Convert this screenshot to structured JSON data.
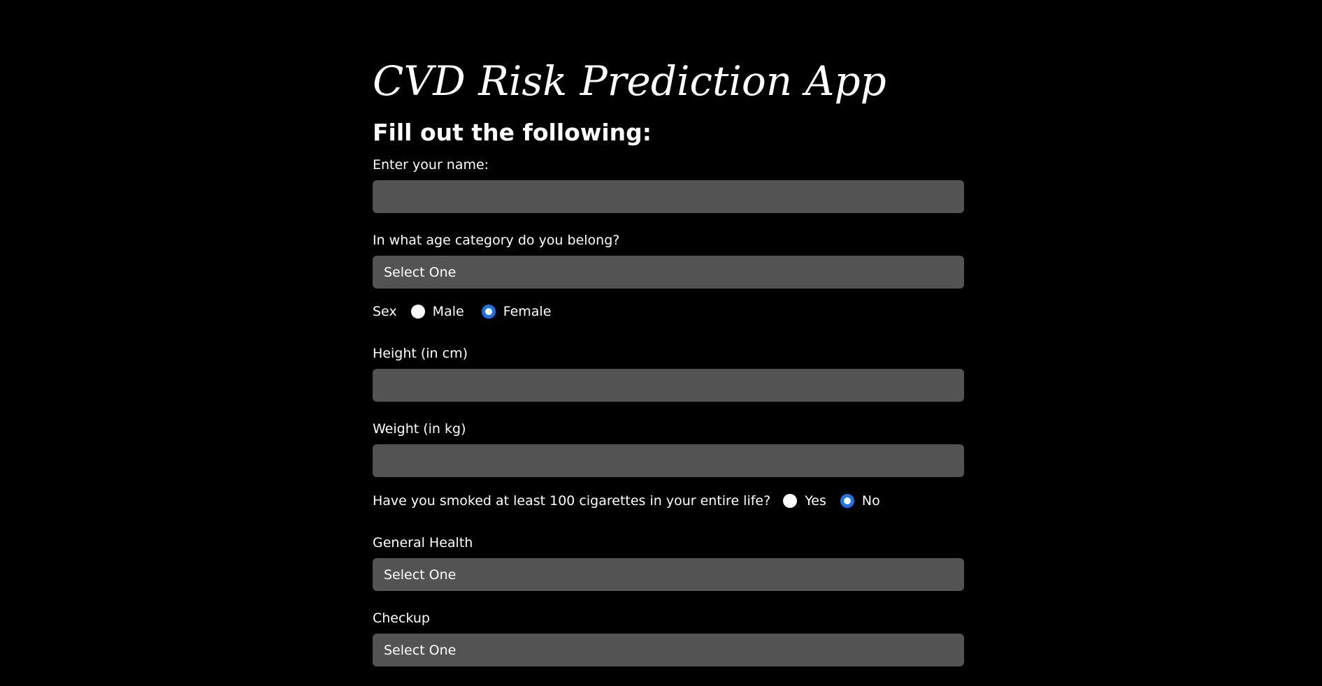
{
  "app": {
    "title": "CVD Risk Prediction App",
    "subtitle": "Fill out the following:"
  },
  "form": {
    "name": {
      "label": "Enter your name:",
      "value": "",
      "placeholder": ""
    },
    "age_category": {
      "label": "In what age category do you belong?",
      "selected": "Select One"
    },
    "sex": {
      "label": "Sex",
      "options": [
        "Male",
        "Female"
      ],
      "selected": "Female"
    },
    "height": {
      "label": "Height (in cm)",
      "value": "",
      "placeholder": ""
    },
    "weight": {
      "label": "Weight (in kg)",
      "value": "",
      "placeholder": ""
    },
    "smoking": {
      "label": "Have you smoked at least 100 cigarettes in your entire life?",
      "options": [
        "Yes",
        "No"
      ],
      "selected": "No"
    },
    "general_health": {
      "label": "General Health",
      "selected": "Select One"
    },
    "checkup": {
      "label": "Checkup",
      "selected": "Select One"
    }
  },
  "colors": {
    "background": "#000000",
    "field_background": "#535353",
    "text": "#ffffff",
    "radio_accent": "#1a73e8"
  }
}
